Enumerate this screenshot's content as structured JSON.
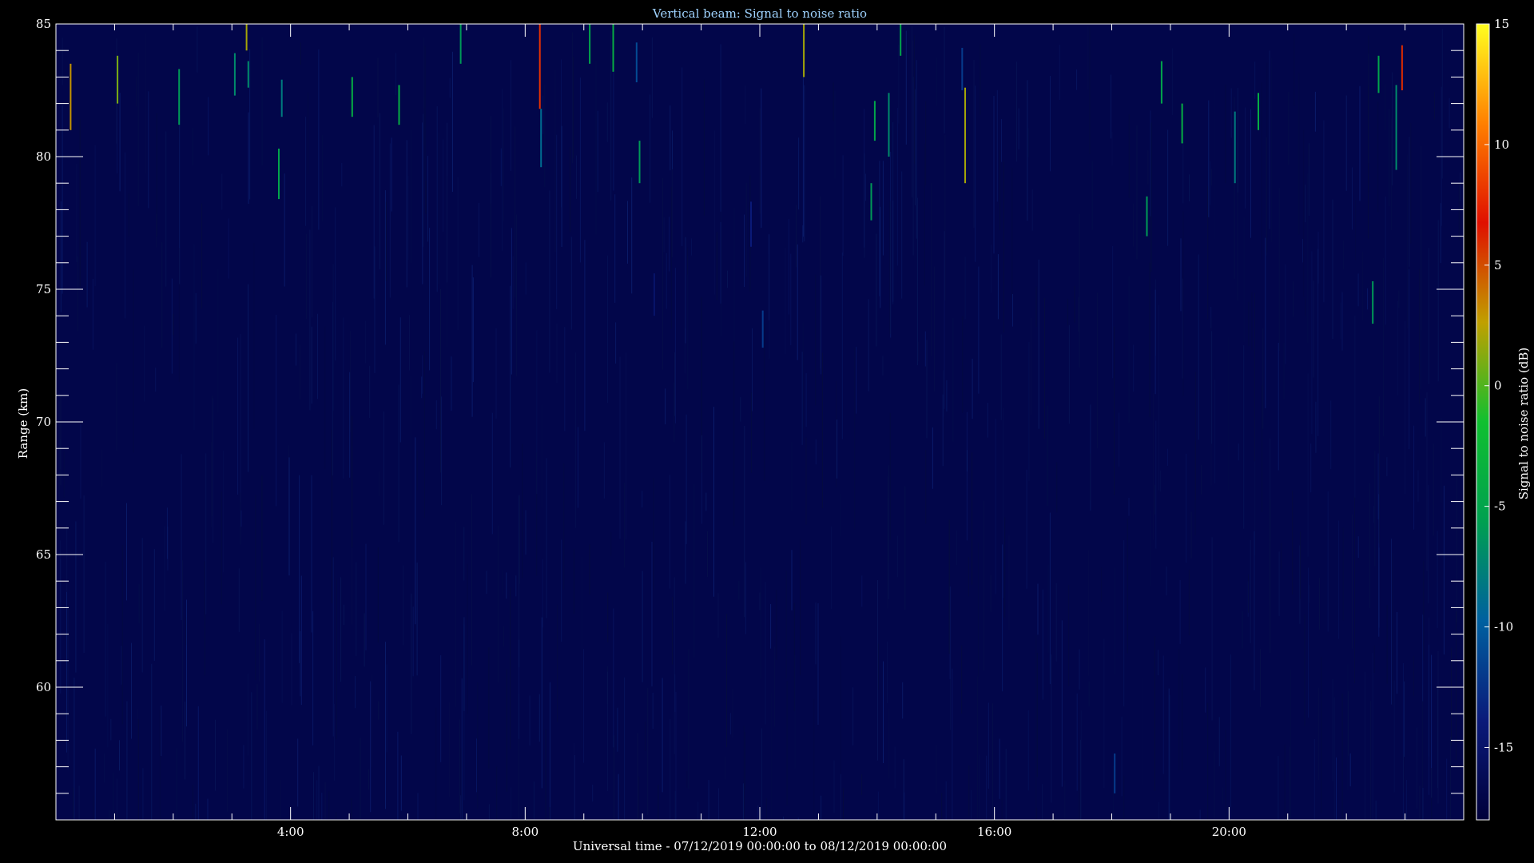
{
  "chart_data": {
    "type": "heatmap",
    "title": "Vertical beam: Signal to noise ratio",
    "xlabel": "Universal time - 07/12/2019 00:00:00 to 08/12/2019 00:00:00",
    "ylabel": "Range (km)",
    "colorbar_label": "Signal to noise ratio (dB)",
    "x_range_hours": [
      0,
      24
    ],
    "x_ticks": [
      {
        "value": 4,
        "label": "4:00"
      },
      {
        "value": 8,
        "label": "8:00"
      },
      {
        "value": 12,
        "label": "12:00"
      },
      {
        "value": 16,
        "label": "16:00"
      },
      {
        "value": 20,
        "label": "20:00"
      }
    ],
    "y_range_km": [
      55,
      85
    ],
    "y_ticks": [
      60,
      65,
      70,
      75,
      80,
      85
    ],
    "colorbar_range_db": [
      -18,
      15
    ],
    "colorbar_ticks": [
      15,
      10,
      5,
      0,
      -5,
      -10,
      -15
    ],
    "background_snr_db": -17,
    "colormap": [
      "#00003a",
      "#0a1a7a",
      "#0060a0",
      "#00a050",
      "#10c030",
      "#c0a000",
      "#e01000",
      "#ff8000",
      "#ffff20"
    ],
    "echoes": [
      {
        "t": 0.25,
        "r0": 81.0,
        "r1": 83.5,
        "snr": 3
      },
      {
        "t": 1.05,
        "r0": 82.0,
        "r1": 83.8,
        "snr": 1
      },
      {
        "t": 2.1,
        "r0": 81.2,
        "r1": 83.3,
        "snr": -6
      },
      {
        "t": 3.05,
        "r0": 82.3,
        "r1": 83.9,
        "snr": -7
      },
      {
        "t": 3.25,
        "r0": 84.0,
        "r1": 85.0,
        "snr": 2
      },
      {
        "t": 3.28,
        "r0": 82.6,
        "r1": 83.6,
        "snr": -7
      },
      {
        "t": 3.8,
        "r0": 78.4,
        "r1": 80.3,
        "snr": -5
      },
      {
        "t": 3.85,
        "r0": 81.5,
        "r1": 82.9,
        "snr": -8
      },
      {
        "t": 5.05,
        "r0": 81.5,
        "r1": 83.0,
        "snr": -4
      },
      {
        "t": 5.85,
        "r0": 81.2,
        "r1": 82.7,
        "snr": -4
      },
      {
        "t": 6.9,
        "r0": 83.5,
        "r1": 85.0,
        "snr": -6
      },
      {
        "t": 8.25,
        "r0": 81.8,
        "r1": 85.0,
        "snr": 8
      },
      {
        "t": 8.27,
        "r0": 79.6,
        "r1": 81.8,
        "snr": -9
      },
      {
        "t": 9.1,
        "r0": 83.5,
        "r1": 85.0,
        "snr": -5
      },
      {
        "t": 9.5,
        "r0": 83.2,
        "r1": 85.0,
        "snr": -4
      },
      {
        "t": 9.9,
        "r0": 82.8,
        "r1": 84.3,
        "snr": -11
      },
      {
        "t": 9.95,
        "r0": 79.0,
        "r1": 80.6,
        "snr": -6
      },
      {
        "t": 10.2,
        "r0": 74.0,
        "r1": 75.6,
        "snr": -15
      },
      {
        "t": 11.85,
        "r0": 76.6,
        "r1": 78.3,
        "snr": -14
      },
      {
        "t": 12.05,
        "r0": 72.8,
        "r1": 74.2,
        "snr": -12
      },
      {
        "t": 12.75,
        "r0": 83.0,
        "r1": 85.0,
        "snr": 2
      },
      {
        "t": 13.9,
        "r0": 77.6,
        "r1": 79.0,
        "snr": -6
      },
      {
        "t": 13.96,
        "r0": 80.6,
        "r1": 82.1,
        "snr": -5
      },
      {
        "t": 14.2,
        "r0": 80.0,
        "r1": 82.4,
        "snr": -7
      },
      {
        "t": 14.4,
        "r0": 83.8,
        "r1": 85.0,
        "snr": -5
      },
      {
        "t": 15.5,
        "r0": 79.0,
        "r1": 82.6,
        "snr": 2
      },
      {
        "t": 15.45,
        "r0": 82.5,
        "r1": 84.1,
        "snr": -12
      },
      {
        "t": 18.05,
        "r0": 56.0,
        "r1": 57.5,
        "snr": -12
      },
      {
        "t": 18.6,
        "r0": 77.0,
        "r1": 78.5,
        "snr": -6
      },
      {
        "t": 18.85,
        "r0": 82.0,
        "r1": 83.6,
        "snr": -5
      },
      {
        "t": 19.2,
        "r0": 80.5,
        "r1": 82.0,
        "snr": -4
      },
      {
        "t": 20.1,
        "r0": 79.0,
        "r1": 81.7,
        "snr": -8
      },
      {
        "t": 20.5,
        "r0": 81.0,
        "r1": 82.4,
        "snr": -4
      },
      {
        "t": 22.45,
        "r0": 73.7,
        "r1": 75.3,
        "snr": -6
      },
      {
        "t": 22.55,
        "r0": 82.4,
        "r1": 83.8,
        "snr": -5
      },
      {
        "t": 22.85,
        "r0": 79.5,
        "r1": 82.7,
        "snr": -7
      },
      {
        "t": 22.95,
        "r0": 82.5,
        "r1": 84.2,
        "snr": 6
      }
    ]
  }
}
